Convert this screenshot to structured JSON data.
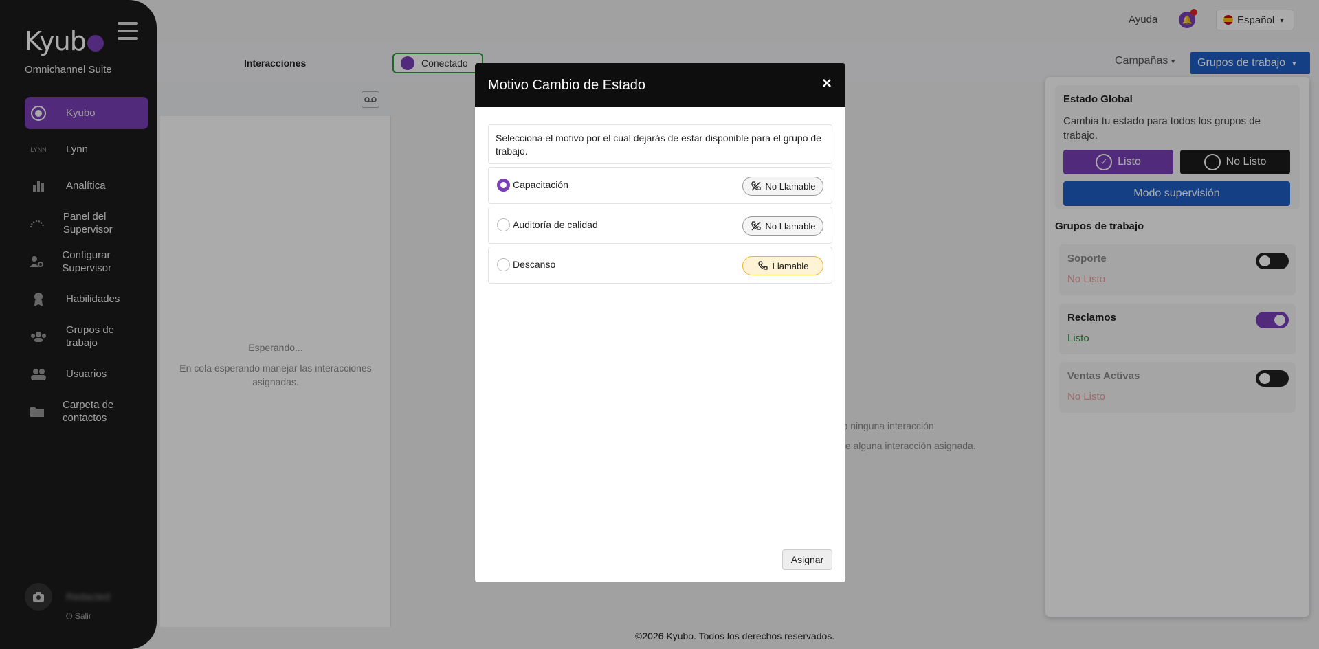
{
  "brand": {
    "name": "Kyub",
    "subtitle": "Omnichannel Suite"
  },
  "sidebar": {
    "items": [
      {
        "label": "Kyubo",
        "icon": "kyubo-icon"
      },
      {
        "label": "Lynn",
        "icon": "lynn-icon",
        "icon_text": "LYNN"
      },
      {
        "label": "Analítica",
        "icon": "bar-chart-icon"
      },
      {
        "label": "Panel del Supervisor",
        "icon": "gauge-icon"
      },
      {
        "label": "Configurar Supervisor",
        "icon": "user-gear-icon"
      },
      {
        "label": "Habilidades",
        "icon": "award-icon"
      },
      {
        "label": "Grupos de trabajo",
        "icon": "group-icon"
      },
      {
        "label": "Usuarios",
        "icon": "users-icon"
      },
      {
        "label": "Carpeta de contactos",
        "icon": "folder-icon"
      }
    ],
    "user_name": "Redacted",
    "logout": "Salir"
  },
  "topbar": {
    "help": "Ayuda",
    "language": "Español"
  },
  "subheader": {
    "tab": "Interacciones",
    "status": "Conectado",
    "campaigns": "Campañas",
    "workgroups": "Grupos de trabajo"
  },
  "pane": {
    "waiting": "Esperando...",
    "waiting_sub": "En cola esperando manejar las interacciones asignadas."
  },
  "center": {
    "line1": "ado ninguna interacción",
    "line2": "ne alguna interacción asignada."
  },
  "footer": "©2026 Kyubo. Todos los derechos reservados.",
  "right_panel": {
    "global_title": "Estado Global",
    "global_desc": "Cambia tu estado para todos los grupos de trabajo.",
    "ready": "Listo",
    "not_ready": "No Listo",
    "supervision": "Modo supervisión",
    "groups_title": "Grupos de trabajo",
    "groups": [
      {
        "name": "Soporte",
        "status": "No Listo",
        "enabled": false
      },
      {
        "name": "Reclamos",
        "status": "Listo",
        "enabled": true
      },
      {
        "name": "Ventas Activas",
        "status": "No Listo",
        "enabled": false
      }
    ]
  },
  "modal": {
    "title": "Motivo Cambio de Estado",
    "close": "×",
    "intro": "Selecciona el motivo por el cual dejarás de estar disponible para el grupo de trabajo.",
    "reasons": [
      {
        "label": "Capacitación",
        "badge": "No Llamable",
        "selected": true
      },
      {
        "label": "Auditoría de calidad",
        "badge": "No Llamable",
        "selected": false
      },
      {
        "label": "Descanso",
        "badge": "Llamable",
        "selected": false
      }
    ],
    "assign": "Asignar"
  },
  "colors": {
    "accent": "#7b3fb8",
    "primary": "#1e5fc7",
    "dark": "#1b1b1b",
    "ok": "#2b8a3e",
    "bad": "#e89b9b"
  }
}
